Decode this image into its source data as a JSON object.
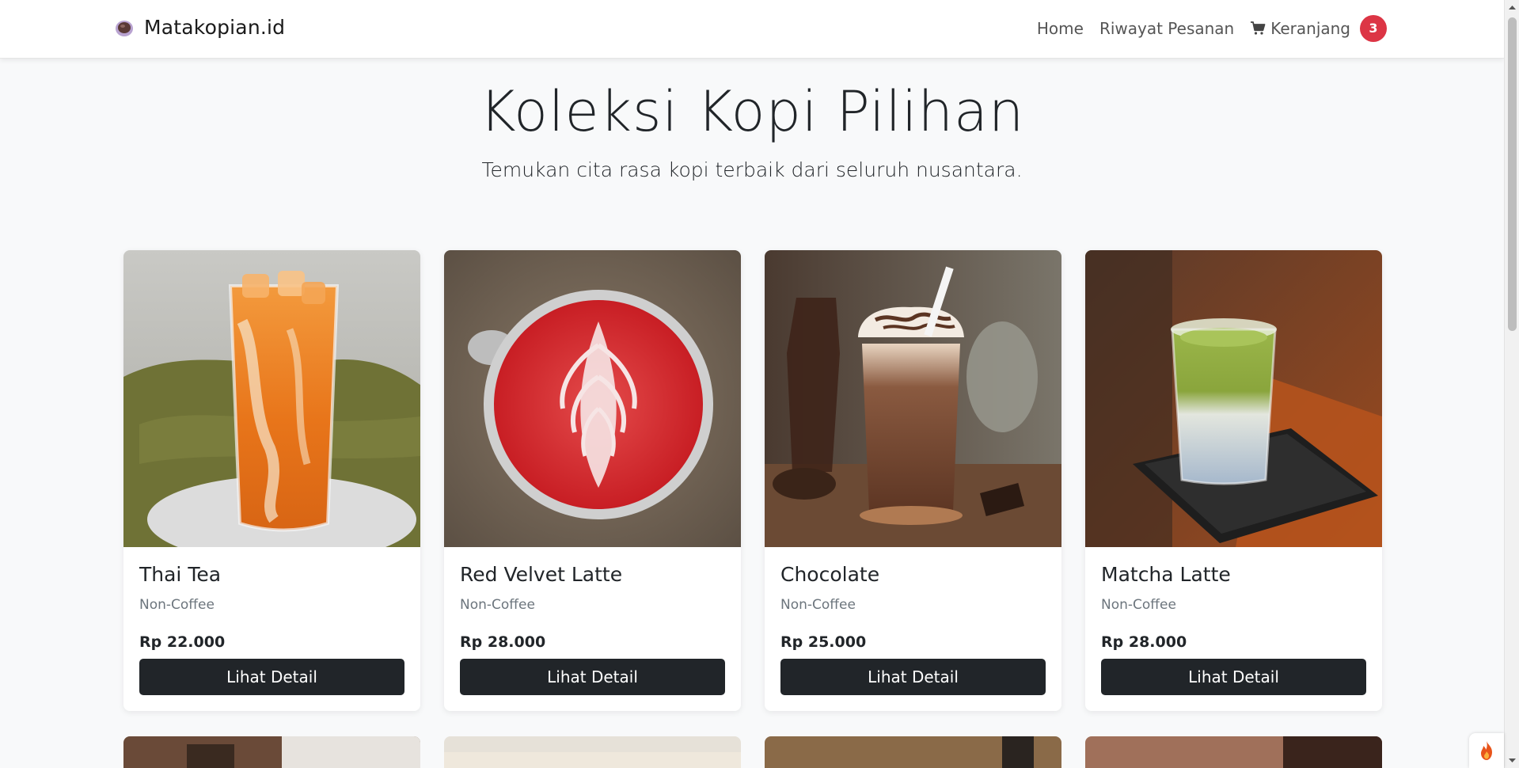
{
  "navbar": {
    "brand": "Matakopian.id",
    "links": [
      {
        "label": "Home"
      },
      {
        "label": "Riwayat Pesanan"
      }
    ],
    "cart": {
      "label": "Keranjang",
      "count": "3"
    }
  },
  "hero": {
    "title": "Koleksi Kopi Pilihan",
    "subtitle": "Temukan cita rasa kopi terbaik dari seluruh nusantara."
  },
  "products": [
    {
      "name": "Thai Tea",
      "category": "Non-Coffee",
      "price": "Rp 22.000",
      "button": "Lihat Detail"
    },
    {
      "name": "Red Velvet Latte",
      "category": "Non-Coffee",
      "price": "Rp 28.000",
      "button": "Lihat Detail"
    },
    {
      "name": "Chocolate",
      "category": "Non-Coffee",
      "price": "Rp 25.000",
      "button": "Lihat Detail"
    },
    {
      "name": "Matcha Latte",
      "category": "Non-Coffee",
      "price": "Rp 28.000",
      "button": "Lihat Detail"
    }
  ],
  "colors": {
    "badge": "#dc3545",
    "button": "#212529",
    "background": "#f8f9fa"
  }
}
